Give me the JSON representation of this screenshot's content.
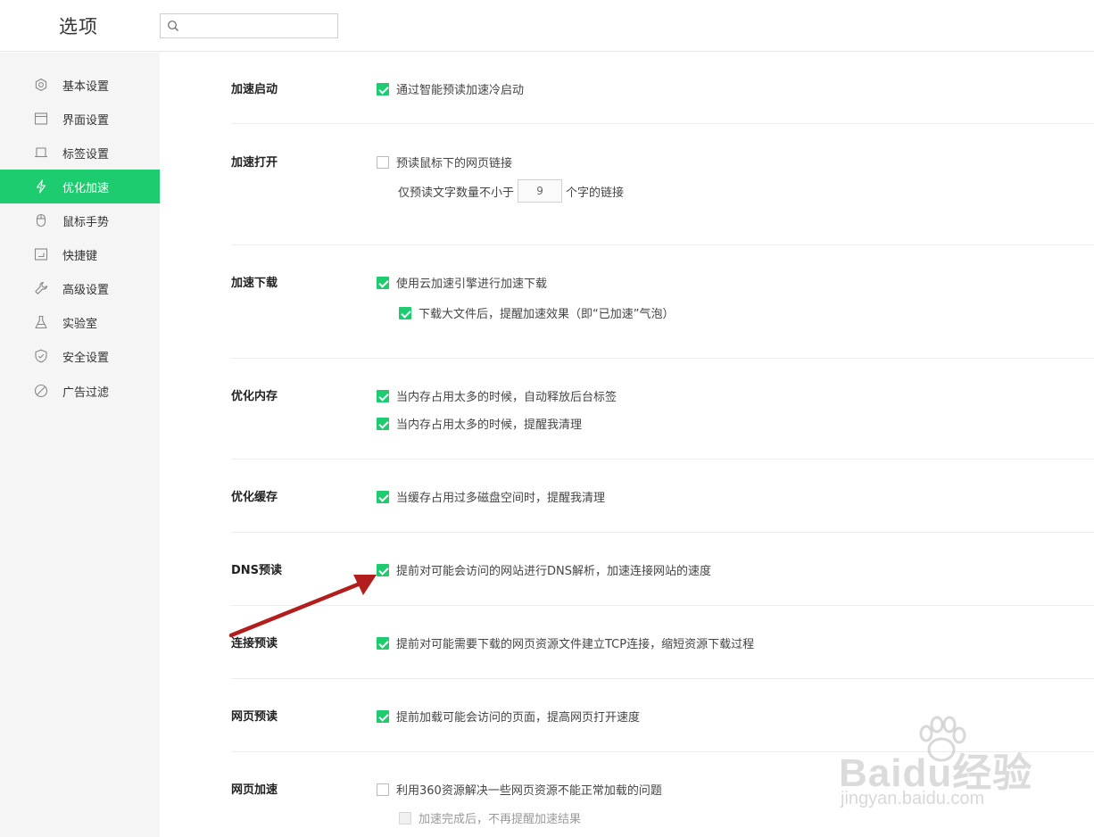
{
  "header": {
    "title": "选项",
    "search_placeholder": ""
  },
  "sidebar": {
    "items": [
      {
        "label": "基本设置",
        "icon": "gear-icon"
      },
      {
        "label": "界面设置",
        "icon": "window-icon"
      },
      {
        "label": "标签设置",
        "icon": "tab-icon"
      },
      {
        "label": "优化加速",
        "icon": "lightning-icon",
        "active": true
      },
      {
        "label": "鼠标手势",
        "icon": "mouse-icon"
      },
      {
        "label": "快捷键",
        "icon": "keyboard-icon"
      },
      {
        "label": "高级设置",
        "icon": "wrench-icon"
      },
      {
        "label": "实验室",
        "icon": "flask-icon"
      },
      {
        "label": "安全设置",
        "icon": "shield-icon"
      },
      {
        "label": "广告过滤",
        "icon": "block-icon"
      }
    ]
  },
  "sections": {
    "startup": {
      "title": "加速启动",
      "opt1": {
        "label": "通过智能预读加速冷启动",
        "checked": true
      }
    },
    "open": {
      "title": "加速打开",
      "opt1": {
        "label": "预读鼠标下的网页链接",
        "checked": false
      },
      "prefix": "仅预读文字数量不小于",
      "value": "9",
      "suffix": "个字的链接"
    },
    "download": {
      "title": "加速下载",
      "opt1": {
        "label": "使用云加速引擎进行加速下载",
        "checked": true
      },
      "opt2": {
        "label": "下载大文件后，提醒加速效果（即“已加速”气泡）",
        "checked": true
      }
    },
    "memory": {
      "title": "优化内存",
      "opt1": {
        "label": "当内存占用太多的时候，自动释放后台标签",
        "checked": true
      },
      "opt2": {
        "label": "当内存占用太多的时候，提醒我清理",
        "checked": true
      }
    },
    "cache": {
      "title": "优化缓存",
      "opt1": {
        "label": "当缓存占用过多磁盘空间时，提醒我清理",
        "checked": true
      }
    },
    "dns": {
      "title": "DNS预读",
      "opt1": {
        "label": "提前对可能会访问的网站进行DNS解析，加速连接网站的速度",
        "checked": true
      }
    },
    "connect": {
      "title": "连接预读",
      "opt1": {
        "label": "提前对可能需要下载的网页资源文件建立TCP连接，缩短资源下载过程",
        "checked": true
      }
    },
    "page": {
      "title": "网页预读",
      "opt1": {
        "label": "提前加载可能会访问的页面，提高网页打开速度",
        "checked": true
      }
    },
    "pageaccel": {
      "title": "网页加速",
      "opt1": {
        "label": "利用360资源解决一些网页资源不能正常加载的问题",
        "checked": false
      },
      "opt2": {
        "label": "加速完成后，不再提醒加速结果",
        "checked": false,
        "disabled": true
      }
    }
  },
  "watermark": {
    "text": "Baidu经验",
    "sub": "jingyan.baidu.com"
  },
  "colors": {
    "accent": "#1ccc6f",
    "arrow": "#b21e1e"
  }
}
